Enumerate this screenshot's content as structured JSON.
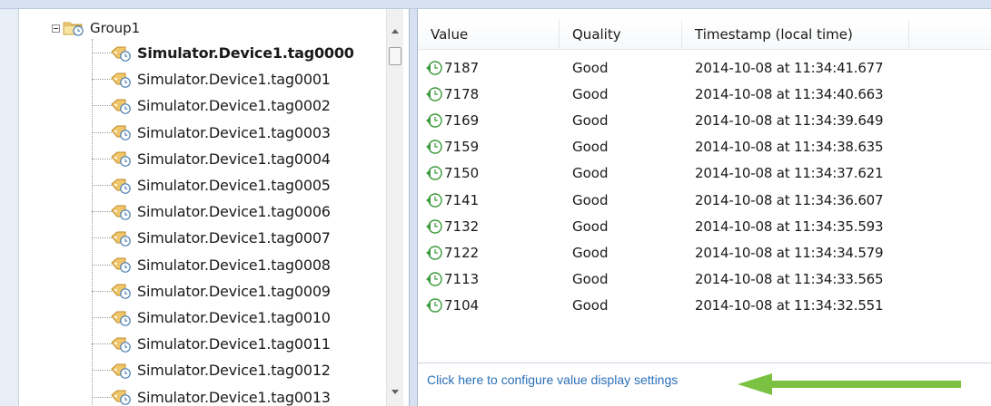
{
  "tree": {
    "group_label": "Group1",
    "tags": [
      {
        "label": "Simulator.Device1.tag0000",
        "bold": true
      },
      {
        "label": "Simulator.Device1.tag0001",
        "bold": false
      },
      {
        "label": "Simulator.Device1.tag0002",
        "bold": false
      },
      {
        "label": "Simulator.Device1.tag0003",
        "bold": false
      },
      {
        "label": "Simulator.Device1.tag0004",
        "bold": false
      },
      {
        "label": "Simulator.Device1.tag0005",
        "bold": false
      },
      {
        "label": "Simulator.Device1.tag0006",
        "bold": false
      },
      {
        "label": "Simulator.Device1.tag0007",
        "bold": false
      },
      {
        "label": "Simulator.Device1.tag0008",
        "bold": false
      },
      {
        "label": "Simulator.Device1.tag0009",
        "bold": false
      },
      {
        "label": "Simulator.Device1.tag0010",
        "bold": false
      },
      {
        "label": "Simulator.Device1.tag0011",
        "bold": false
      },
      {
        "label": "Simulator.Device1.tag0012",
        "bold": false
      },
      {
        "label": "Simulator.Device1.tag0013",
        "bold": false
      }
    ]
  },
  "table": {
    "columns": [
      "Value",
      "Quality",
      "Timestamp (local time)"
    ],
    "rows": [
      {
        "value": "7187",
        "quality": "Good",
        "timestamp": "2014-10-08 at 11:34:41.677"
      },
      {
        "value": "7178",
        "quality": "Good",
        "timestamp": "2014-10-08 at 11:34:40.663"
      },
      {
        "value": "7169",
        "quality": "Good",
        "timestamp": "2014-10-08 at 11:34:39.649"
      },
      {
        "value": "7159",
        "quality": "Good",
        "timestamp": "2014-10-08 at 11:34:38.635"
      },
      {
        "value": "7150",
        "quality": "Good",
        "timestamp": "2014-10-08 at 11:34:37.621"
      },
      {
        "value": "7141",
        "quality": "Good",
        "timestamp": "2014-10-08 at 11:34:36.607"
      },
      {
        "value": "7132",
        "quality": "Good",
        "timestamp": "2014-10-08 at 11:34:35.593"
      },
      {
        "value": "7122",
        "quality": "Good",
        "timestamp": "2014-10-08 at 11:34:34.579"
      },
      {
        "value": "7113",
        "quality": "Good",
        "timestamp": "2014-10-08 at 11:34:33.565"
      },
      {
        "value": "7104",
        "quality": "Good",
        "timestamp": "2014-10-08 at 11:34:32.551"
      }
    ]
  },
  "footer": {
    "config_link": "Click here to configure value display settings"
  },
  "icons": {
    "group": "folder-clock-icon",
    "tag": "tag-clock-icon",
    "value": "green-arrow-clock-icon",
    "annotation": "green-arrow-icon"
  },
  "colors": {
    "link": "#2a6fb8",
    "annotation_arrow": "#7cc242",
    "pane_border": "#d6e2f1"
  }
}
